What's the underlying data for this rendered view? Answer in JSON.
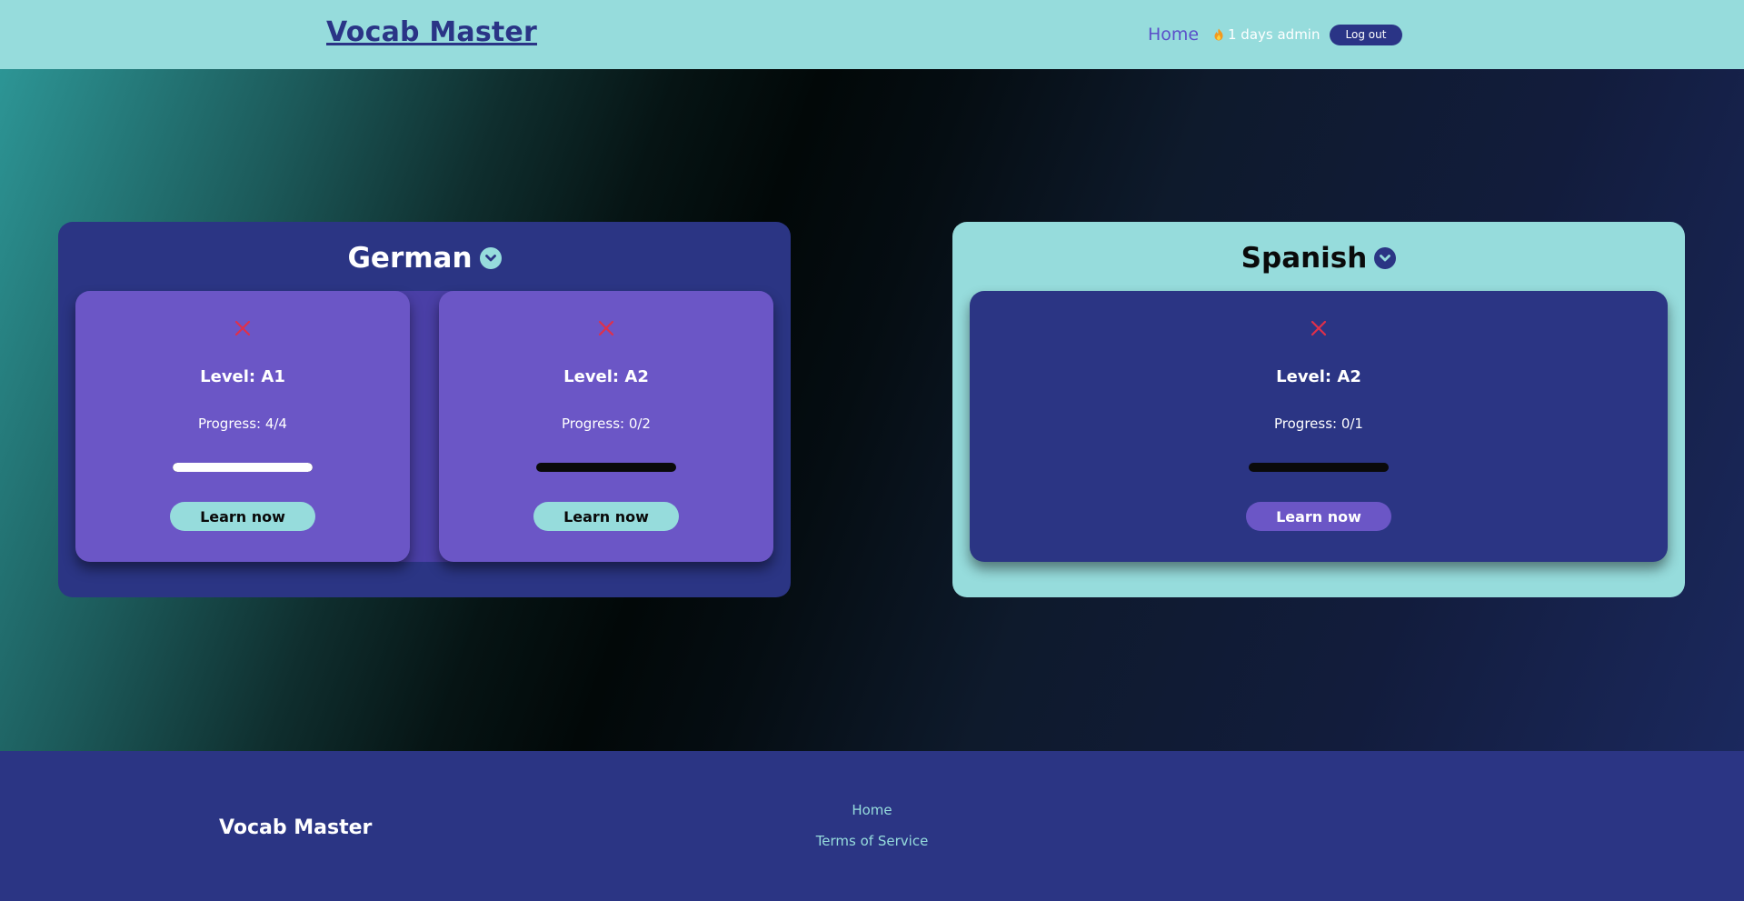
{
  "header": {
    "brand": "Vocab Master",
    "nav_home": "Home",
    "streak_text": "1 days admin",
    "streak_icon": "fire-icon",
    "logout_label": "Log out"
  },
  "languages": [
    {
      "name": "German",
      "toggle_icon": "chevron-down-icon",
      "levels": [
        {
          "level": "Level: A1",
          "progress": "Progress: 4/4",
          "progress_fraction": 1.0,
          "status_icon": "close-icon",
          "action": "Learn now"
        },
        {
          "level": "Level: A2",
          "progress": "Progress: 0/2",
          "progress_fraction": 0.0,
          "status_icon": "close-icon",
          "action": "Learn now"
        }
      ]
    },
    {
      "name": "Spanish",
      "toggle_icon": "chevron-down-icon",
      "levels": [
        {
          "level": "Level: A2",
          "progress": "Progress: 0/1",
          "progress_fraction": 0.0,
          "status_icon": "close-icon",
          "action": "Learn now"
        }
      ]
    }
  ],
  "footer": {
    "brand": "Vocab Master",
    "links": [
      "Home",
      "Terms of Service"
    ]
  },
  "colors": {
    "header_bg": "#96dcdc",
    "navy": "#2b3584",
    "purple": "#6b56c6",
    "close_red": "#e0304a"
  }
}
